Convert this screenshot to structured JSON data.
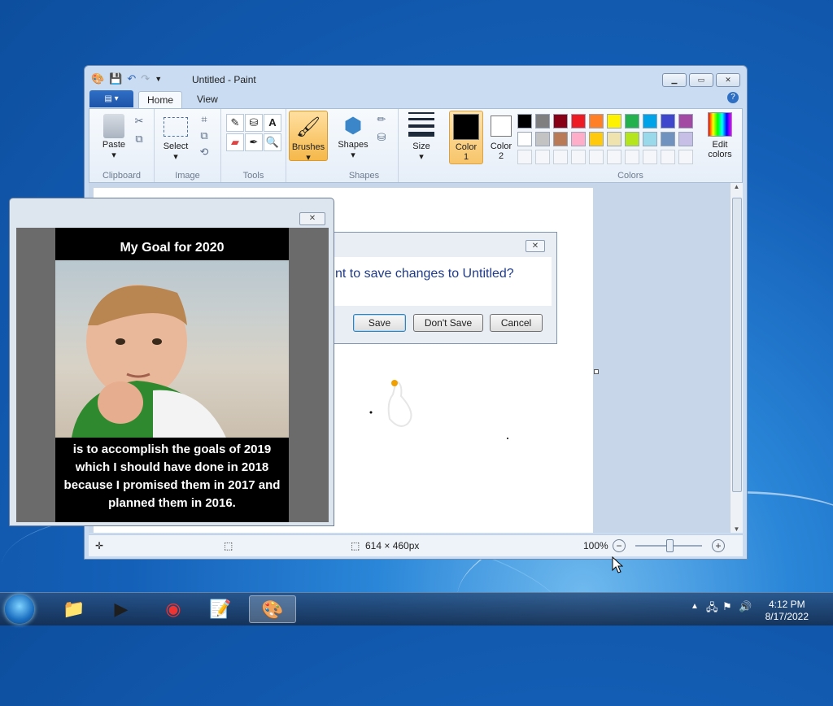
{
  "paint": {
    "title": "Untitled - Paint",
    "tabs": [
      "Home",
      "View"
    ],
    "file_tab_icon": "file-menu-icon",
    "groups": {
      "clipboard": {
        "label": "Clipboard",
        "paste": "Paste"
      },
      "image": {
        "label": "Image",
        "select": "Select"
      },
      "tools": {
        "label": "Tools"
      },
      "brushes": {
        "label": "Brushes"
      },
      "shapes": {
        "label": "Shapes",
        "button": "Shapes"
      },
      "size": {
        "label": "Size"
      },
      "color1": {
        "line1": "Color",
        "line2": "1"
      },
      "color2": {
        "line1": "Color",
        "line2": "2"
      },
      "colors": {
        "label": "Colors",
        "edit_line1": "Edit",
        "edit_line2": "colors"
      }
    },
    "palette_row1": [
      "#000000",
      "#7f7f7f",
      "#880015",
      "#ed1c24",
      "#ff7f27",
      "#fff200",
      "#22b14c",
      "#00a2e8",
      "#3f48cc",
      "#a349a4"
    ],
    "palette_row2": [
      "#ffffff",
      "#c3c3c3",
      "#b97a57",
      "#ffaec9",
      "#ffc90e",
      "#efe4b0",
      "#b5e61d",
      "#99d9ea",
      "#7092be",
      "#c8bfe7"
    ],
    "status": {
      "dimensions": "614 × 460px",
      "zoom": "100%"
    }
  },
  "dialog": {
    "message": "nt to save changes to Untitled?",
    "save": "Save",
    "dont_save": "Don't Save",
    "cancel": "Cancel"
  },
  "meme": {
    "top_text": "My Goal for 2020",
    "bottom_text": "is to accomplish the goals of 2019 which I should have done in 2018 because I promised them in 2017 and planned them in 2016."
  },
  "taskbar": {
    "time": "4:12 PM",
    "date": "8/17/2022"
  }
}
